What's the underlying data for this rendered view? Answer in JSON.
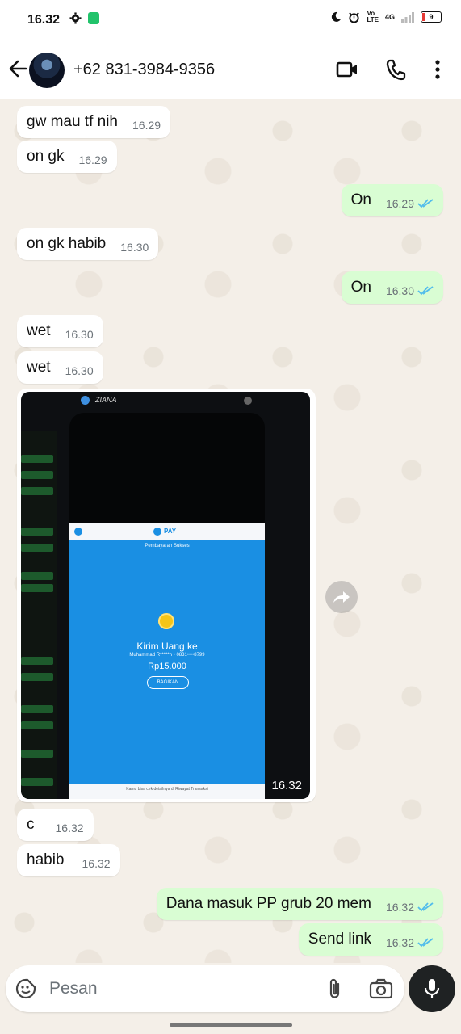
{
  "status": {
    "time": "16.32",
    "battery": "9",
    "network": "4G"
  },
  "header": {
    "contact": "+62 831-3984-9356"
  },
  "messages": [
    {
      "text": "gw mau tf nih",
      "time": "16.29"
    },
    {
      "text": "on gk",
      "time": "16.29"
    },
    {
      "text": "On",
      "time": "16.29"
    },
    {
      "text": "on gk habib",
      "time": "16.30"
    },
    {
      "text": "On",
      "time": "16.30"
    },
    {
      "text": "wet",
      "time": "16.30"
    },
    {
      "text": "wet",
      "time": "16.30"
    },
    {
      "text": "c",
      "time": "16.32"
    },
    {
      "text": "habib",
      "time": "16.32"
    },
    {
      "text": "Dana masuk PP grub 20 mem",
      "time": "16.32"
    },
    {
      "text": "Send link",
      "time": "16.32"
    }
  ],
  "image_message": {
    "time": "16.32",
    "inner": {
      "app_name": "ZIANA",
      "brand": "PAY",
      "status": "Pembayaran Sukses",
      "heading": "Kirim Uang ke",
      "recipient": "Muhammad R*****n • 0831••••8799",
      "amount": "Rp15.000",
      "share_label": "BAGIKAN",
      "footer": "Kamu bisa cek detailnya di Riwayat Transaksi"
    }
  },
  "composer": {
    "placeholder": "Pesan"
  },
  "colors": {
    "incoming": "#ffffff",
    "outgoing": "#d9fdd3",
    "read_ticks": "#53bdeb",
    "chat_bg": "#f4efe8"
  }
}
